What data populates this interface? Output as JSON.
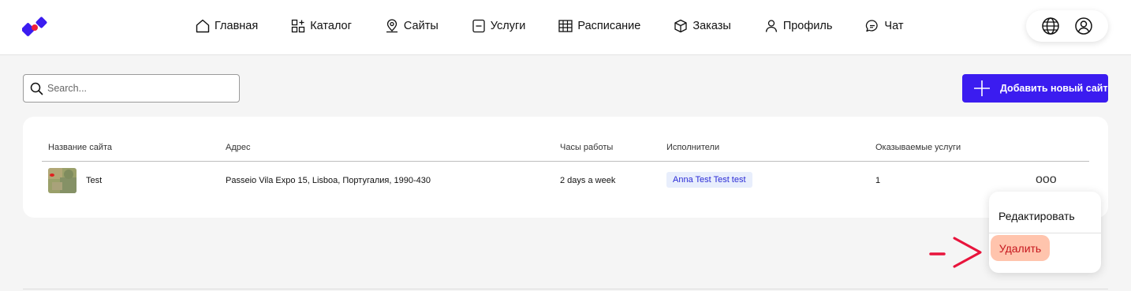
{
  "header": {
    "nav": [
      {
        "label": "Главная",
        "icon": "home-icon"
      },
      {
        "label": "Каталог",
        "icon": "catalog-icon"
      },
      {
        "label": "Сайты",
        "icon": "location-pin-icon"
      },
      {
        "label": "Услуги",
        "icon": "services-icon"
      },
      {
        "label": "Расписание",
        "icon": "calendar-grid-icon"
      },
      {
        "label": "Заказы",
        "icon": "box-icon"
      },
      {
        "label": "Профиль",
        "icon": "user-icon"
      },
      {
        "label": "Чат",
        "icon": "chat-icon"
      }
    ],
    "actions": [
      "globe-icon",
      "account-icon"
    ]
  },
  "search": {
    "placeholder": "Search..."
  },
  "add_button": {
    "label": "Добавить новый сайт"
  },
  "table": {
    "columns": [
      "Название сайта",
      "Адрес",
      "Часы работы",
      "Исполнители",
      "Оказываемые услуги"
    ],
    "rows": [
      {
        "name": "Test",
        "address": "Passeio Vila Expo 15, Lisboa, Португалия, 1990-430",
        "hours": "2 days a week",
        "performer": "Anna Test Test test",
        "services_count": "1",
        "more": "ooo"
      }
    ]
  },
  "context_menu": {
    "edit": "Редактировать",
    "delete": "Удалить"
  },
  "colors": {
    "accent": "#3b1cf0",
    "delete_bg": "#ffc4ad",
    "delete_text": "#c6161d",
    "annotation": "#e8143c"
  }
}
